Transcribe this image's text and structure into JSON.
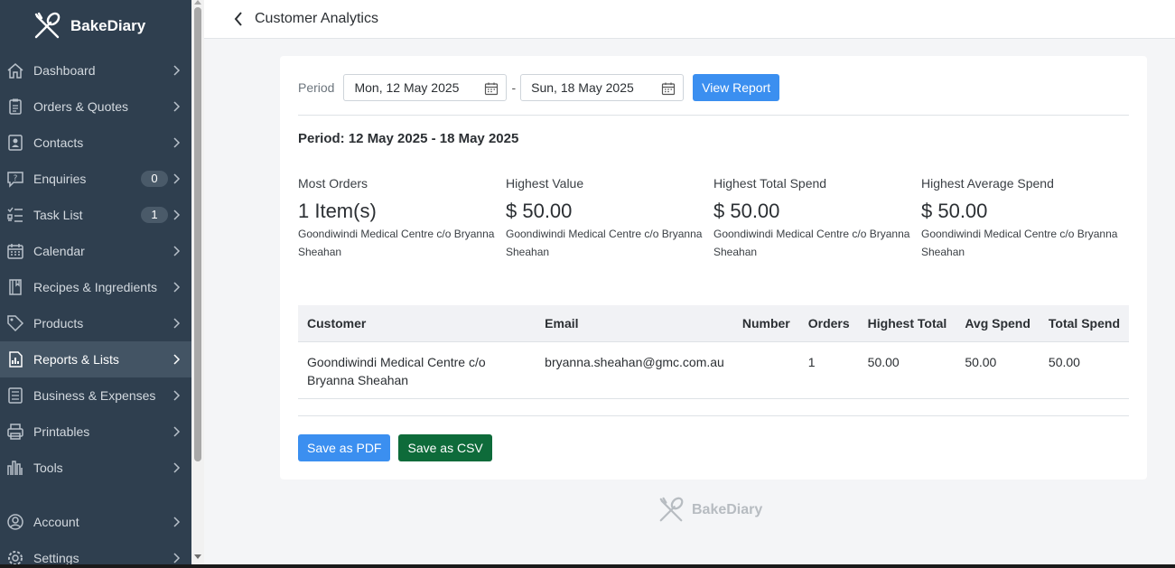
{
  "app": {
    "name": "BakeDiary"
  },
  "sidebar": {
    "items": [
      {
        "label": "Dashboard",
        "icon": "home-icon"
      },
      {
        "label": "Orders & Quotes",
        "icon": "clipboard-icon"
      },
      {
        "label": "Contacts",
        "icon": "contact-card-icon"
      },
      {
        "label": "Enquiries",
        "icon": "question-bubble-icon",
        "badge": "0"
      },
      {
        "label": "Task List",
        "icon": "checklist-icon",
        "badge": "1"
      },
      {
        "label": "Calendar",
        "icon": "calendar-icon"
      },
      {
        "label": "Recipes & Ingredients",
        "icon": "book-icon"
      },
      {
        "label": "Products",
        "icon": "tag-icon"
      },
      {
        "label": "Reports & Lists",
        "icon": "report-icon",
        "active": true
      },
      {
        "label": "Business & Expenses",
        "icon": "ledger-icon"
      },
      {
        "label": "Printables",
        "icon": "printer-icon"
      },
      {
        "label": "Tools",
        "icon": "tools-icon"
      }
    ],
    "bottom_items": [
      {
        "label": "Account",
        "icon": "account-icon"
      },
      {
        "label": "Settings",
        "icon": "settings-icon"
      }
    ]
  },
  "header": {
    "title": "Customer Analytics"
  },
  "filter": {
    "period_label": "Period",
    "start_date": "Mon, 12 May 2025",
    "end_date": "Sun, 18 May 2025",
    "separator": "-",
    "view_button": "View Report"
  },
  "period_heading": "Period: 12 May 2025 - 18 May 2025",
  "stats": [
    {
      "label": "Most Orders",
      "value": "1 Item(s)",
      "customer": "Goondiwindi Medical Centre c/o Bryanna Sheahan"
    },
    {
      "label": "Highest Value",
      "value": "$ 50.00",
      "customer": "Goondiwindi Medical Centre c/o Bryanna Sheahan"
    },
    {
      "label": "Highest Total Spend",
      "value": "$ 50.00",
      "customer": "Goondiwindi Medical Centre c/o Bryanna Sheahan"
    },
    {
      "label": "Highest Average Spend",
      "value": "$ 50.00",
      "customer": "Goondiwindi Medical Centre c/o Bryanna Sheahan"
    }
  ],
  "table": {
    "columns": [
      "Customer",
      "Email",
      "Number",
      "Orders",
      "Highest Total",
      "Avg Spend",
      "Total Spend"
    ],
    "rows": [
      {
        "customer": "Goondiwindi Medical Centre c/o Bryanna Sheahan",
        "email": "bryanna.sheahan@gmc.com.au",
        "number": "",
        "orders": "1",
        "highest_total": "50.00",
        "avg_spend": "50.00",
        "total_spend": "50.00"
      }
    ]
  },
  "actions": {
    "pdf": "Save as PDF",
    "csv": "Save as CSV"
  },
  "footer": {
    "brand": "BakeDiary"
  },
  "colors": {
    "sidebar": "#2f3f4f",
    "primary": "#3b8ff0",
    "success": "#0e6b3a"
  }
}
